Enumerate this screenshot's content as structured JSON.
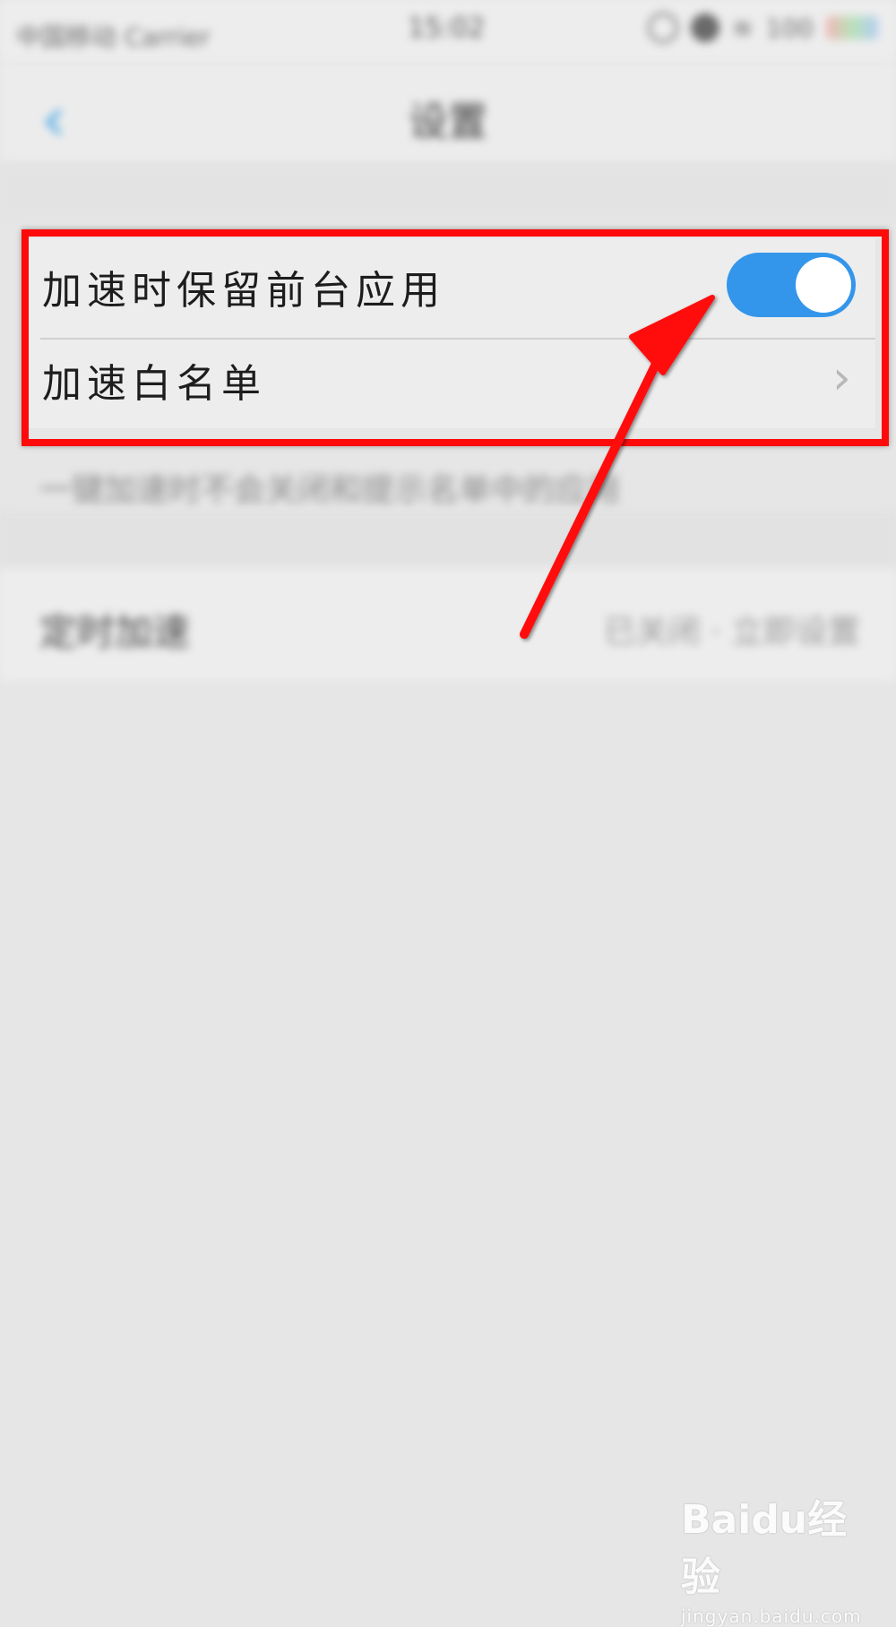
{
  "status_bar": {
    "carrier": "中国移动 Carrier",
    "time": "15:02",
    "battery": "100"
  },
  "nav": {
    "back_glyph": "‹",
    "title": "设置"
  },
  "settings": {
    "items": [
      {
        "label": "加速时保留前台应用",
        "toggle_on": true
      },
      {
        "label": "加速白名单",
        "chevron": "›"
      }
    ]
  },
  "hint": {
    "text": "一键加速时不会关闭和提示名单中的应用"
  },
  "schedule": {
    "label": "定时加速",
    "value": "已关闭 · 立即设置"
  },
  "watermark": {
    "logo": "Baidu经验",
    "url": "jingyan.baidu.com"
  },
  "colors": {
    "accent": "#3396ea",
    "highlight": "#ff0a0a"
  }
}
